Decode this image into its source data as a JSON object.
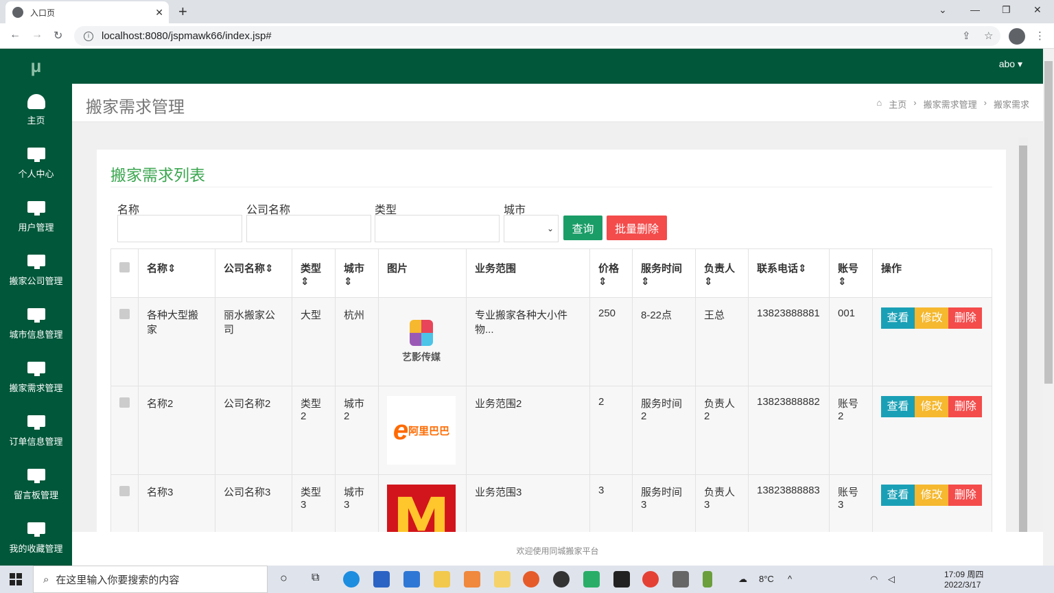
{
  "browser": {
    "tab_title": "入口页",
    "url": "localhost:8080/jspmawk66/index.jsp#"
  },
  "sidebar": {
    "logo": "μ",
    "items": [
      {
        "label": "主页",
        "icon": "dashboard-icon"
      },
      {
        "label": "个人中心",
        "icon": "monitor-icon"
      },
      {
        "label": "用户管理",
        "icon": "monitor-icon"
      },
      {
        "label": "搬家公司管理",
        "icon": "monitor-icon"
      },
      {
        "label": "城市信息管理",
        "icon": "monitor-icon"
      },
      {
        "label": "搬家需求管理",
        "icon": "monitor-icon"
      },
      {
        "label": "订单信息管理",
        "icon": "monitor-icon"
      },
      {
        "label": "留言板管理",
        "icon": "monitor-icon"
      },
      {
        "label": "我的收藏管理",
        "icon": "monitor-icon"
      }
    ]
  },
  "topbar": {
    "user": "abo"
  },
  "header": {
    "title": "搬家需求管理",
    "breadcrumb": [
      "主页",
      "搬家需求管理",
      "搬家需求"
    ]
  },
  "panel": {
    "title": "搬家需求列表",
    "filters": [
      {
        "label": "名称",
        "value": ""
      },
      {
        "label": "公司名称",
        "value": ""
      },
      {
        "label": "类型",
        "value": ""
      },
      {
        "label": "城市",
        "value": ""
      }
    ],
    "query_label": "查询",
    "bulk_delete_label": "批量删除"
  },
  "table": {
    "columns": [
      "名称",
      "公司名称",
      "类型",
      "城市",
      "图片",
      "业务范围",
      "价格",
      "服务时间",
      "负责人",
      "联系电话",
      "账号",
      "操作"
    ],
    "rows": [
      {
        "name": "各种大型搬家",
        "company": "丽水搬家公司",
        "type": "大型",
        "city": "杭州",
        "image": "艺影传媒",
        "scope": "专业搬家各种大小件物...",
        "price": "250",
        "time": "8-22点",
        "owner": "王总",
        "phone": "13823888881",
        "account": "001"
      },
      {
        "name": "名称2",
        "company": "公司名称2",
        "type": "类型2",
        "city": "城市2",
        "image": "阿里巴巴",
        "scope": "业务范围2",
        "price": "2",
        "time": "服务时间2",
        "owner": "负责人2",
        "phone": "13823888882",
        "account": "账号2"
      },
      {
        "name": "名称3",
        "company": "公司名称3",
        "type": "类型3",
        "city": "城市3",
        "image": "M",
        "scope": "业务范围3",
        "price": "3",
        "time": "服务时间3",
        "owner": "负责人3",
        "phone": "13823888883",
        "account": "账号3"
      }
    ],
    "actions": {
      "view": "查看",
      "edit": "修改",
      "delete": "删除"
    }
  },
  "footer": "欢迎使用同城搬家平台",
  "taskbar": {
    "search_placeholder": "在这里输入你要搜索的内容",
    "weather": "8°C",
    "time": "17:09 周四",
    "date": "2022/3/17"
  }
}
